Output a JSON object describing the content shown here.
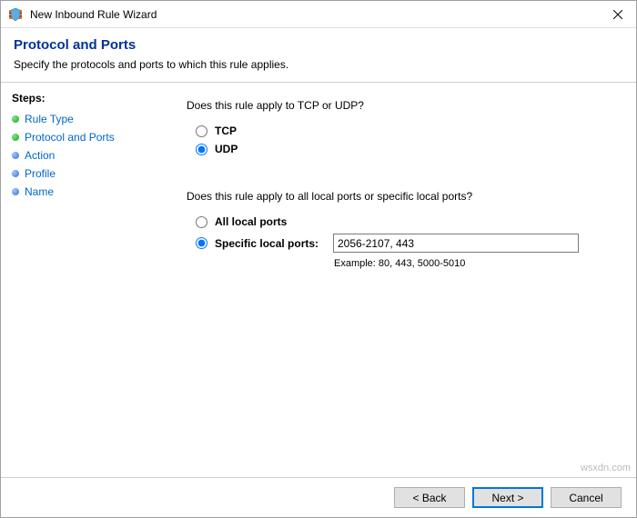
{
  "window": {
    "title": "New Inbound Rule Wizard",
    "close_label": "×"
  },
  "header": {
    "title": "Protocol and Ports",
    "subtitle": "Specify the protocols and ports to which this rule applies."
  },
  "sidebar": {
    "title": "Steps:",
    "items": [
      {
        "label": "Rule Type",
        "state": "done"
      },
      {
        "label": "Protocol and Ports",
        "state": "current"
      },
      {
        "label": "Action",
        "state": "pending"
      },
      {
        "label": "Profile",
        "state": "pending"
      },
      {
        "label": "Name",
        "state": "pending"
      }
    ]
  },
  "content": {
    "protocol_question": "Does this rule apply to TCP or UDP?",
    "tcp_label": "TCP",
    "udp_label": "UDP",
    "protocol_selected": "UDP",
    "ports_question": "Does this rule apply to all local ports or specific local ports?",
    "all_ports_label": "All local ports",
    "specific_ports_label": "Specific local ports:",
    "ports_selected": "specific",
    "ports_value": "2056-2107, 443",
    "ports_example": "Example: 80, 443, 5000-5010"
  },
  "footer": {
    "back_label": "< Back",
    "next_label": "Next >",
    "cancel_label": "Cancel"
  },
  "watermark": "wsxdn.com"
}
